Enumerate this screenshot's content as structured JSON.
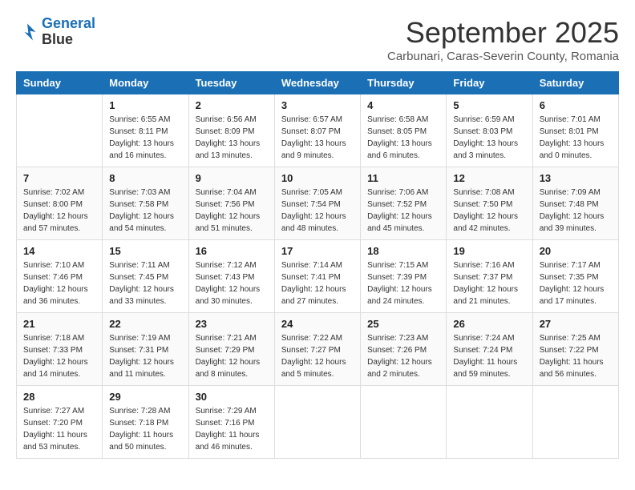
{
  "header": {
    "logo_line1": "General",
    "logo_line2": "Blue",
    "month_title": "September 2025",
    "subtitle": "Carbunari, Caras-Severin County, Romania"
  },
  "weekdays": [
    "Sunday",
    "Monday",
    "Tuesday",
    "Wednesday",
    "Thursday",
    "Friday",
    "Saturday"
  ],
  "weeks": [
    [
      {
        "day": "",
        "sunrise": "",
        "sunset": "",
        "daylight": ""
      },
      {
        "day": "1",
        "sunrise": "Sunrise: 6:55 AM",
        "sunset": "Sunset: 8:11 PM",
        "daylight": "Daylight: 13 hours and 16 minutes."
      },
      {
        "day": "2",
        "sunrise": "Sunrise: 6:56 AM",
        "sunset": "Sunset: 8:09 PM",
        "daylight": "Daylight: 13 hours and 13 minutes."
      },
      {
        "day": "3",
        "sunrise": "Sunrise: 6:57 AM",
        "sunset": "Sunset: 8:07 PM",
        "daylight": "Daylight: 13 hours and 9 minutes."
      },
      {
        "day": "4",
        "sunrise": "Sunrise: 6:58 AM",
        "sunset": "Sunset: 8:05 PM",
        "daylight": "Daylight: 13 hours and 6 minutes."
      },
      {
        "day": "5",
        "sunrise": "Sunrise: 6:59 AM",
        "sunset": "Sunset: 8:03 PM",
        "daylight": "Daylight: 13 hours and 3 minutes."
      },
      {
        "day": "6",
        "sunrise": "Sunrise: 7:01 AM",
        "sunset": "Sunset: 8:01 PM",
        "daylight": "Daylight: 13 hours and 0 minutes."
      }
    ],
    [
      {
        "day": "7",
        "sunrise": "Sunrise: 7:02 AM",
        "sunset": "Sunset: 8:00 PM",
        "daylight": "Daylight: 12 hours and 57 minutes."
      },
      {
        "day": "8",
        "sunrise": "Sunrise: 7:03 AM",
        "sunset": "Sunset: 7:58 PM",
        "daylight": "Daylight: 12 hours and 54 minutes."
      },
      {
        "day": "9",
        "sunrise": "Sunrise: 7:04 AM",
        "sunset": "Sunset: 7:56 PM",
        "daylight": "Daylight: 12 hours and 51 minutes."
      },
      {
        "day": "10",
        "sunrise": "Sunrise: 7:05 AM",
        "sunset": "Sunset: 7:54 PM",
        "daylight": "Daylight: 12 hours and 48 minutes."
      },
      {
        "day": "11",
        "sunrise": "Sunrise: 7:06 AM",
        "sunset": "Sunset: 7:52 PM",
        "daylight": "Daylight: 12 hours and 45 minutes."
      },
      {
        "day": "12",
        "sunrise": "Sunrise: 7:08 AM",
        "sunset": "Sunset: 7:50 PM",
        "daylight": "Daylight: 12 hours and 42 minutes."
      },
      {
        "day": "13",
        "sunrise": "Sunrise: 7:09 AM",
        "sunset": "Sunset: 7:48 PM",
        "daylight": "Daylight: 12 hours and 39 minutes."
      }
    ],
    [
      {
        "day": "14",
        "sunrise": "Sunrise: 7:10 AM",
        "sunset": "Sunset: 7:46 PM",
        "daylight": "Daylight: 12 hours and 36 minutes."
      },
      {
        "day": "15",
        "sunrise": "Sunrise: 7:11 AM",
        "sunset": "Sunset: 7:45 PM",
        "daylight": "Daylight: 12 hours and 33 minutes."
      },
      {
        "day": "16",
        "sunrise": "Sunrise: 7:12 AM",
        "sunset": "Sunset: 7:43 PM",
        "daylight": "Daylight: 12 hours and 30 minutes."
      },
      {
        "day": "17",
        "sunrise": "Sunrise: 7:14 AM",
        "sunset": "Sunset: 7:41 PM",
        "daylight": "Daylight: 12 hours and 27 minutes."
      },
      {
        "day": "18",
        "sunrise": "Sunrise: 7:15 AM",
        "sunset": "Sunset: 7:39 PM",
        "daylight": "Daylight: 12 hours and 24 minutes."
      },
      {
        "day": "19",
        "sunrise": "Sunrise: 7:16 AM",
        "sunset": "Sunset: 7:37 PM",
        "daylight": "Daylight: 12 hours and 21 minutes."
      },
      {
        "day": "20",
        "sunrise": "Sunrise: 7:17 AM",
        "sunset": "Sunset: 7:35 PM",
        "daylight": "Daylight: 12 hours and 17 minutes."
      }
    ],
    [
      {
        "day": "21",
        "sunrise": "Sunrise: 7:18 AM",
        "sunset": "Sunset: 7:33 PM",
        "daylight": "Daylight: 12 hours and 14 minutes."
      },
      {
        "day": "22",
        "sunrise": "Sunrise: 7:19 AM",
        "sunset": "Sunset: 7:31 PM",
        "daylight": "Daylight: 12 hours and 11 minutes."
      },
      {
        "day": "23",
        "sunrise": "Sunrise: 7:21 AM",
        "sunset": "Sunset: 7:29 PM",
        "daylight": "Daylight: 12 hours and 8 minutes."
      },
      {
        "day": "24",
        "sunrise": "Sunrise: 7:22 AM",
        "sunset": "Sunset: 7:27 PM",
        "daylight": "Daylight: 12 hours and 5 minutes."
      },
      {
        "day": "25",
        "sunrise": "Sunrise: 7:23 AM",
        "sunset": "Sunset: 7:26 PM",
        "daylight": "Daylight: 12 hours and 2 minutes."
      },
      {
        "day": "26",
        "sunrise": "Sunrise: 7:24 AM",
        "sunset": "Sunset: 7:24 PM",
        "daylight": "Daylight: 11 hours and 59 minutes."
      },
      {
        "day": "27",
        "sunrise": "Sunrise: 7:25 AM",
        "sunset": "Sunset: 7:22 PM",
        "daylight": "Daylight: 11 hours and 56 minutes."
      }
    ],
    [
      {
        "day": "28",
        "sunrise": "Sunrise: 7:27 AM",
        "sunset": "Sunset: 7:20 PM",
        "daylight": "Daylight: 11 hours and 53 minutes."
      },
      {
        "day": "29",
        "sunrise": "Sunrise: 7:28 AM",
        "sunset": "Sunset: 7:18 PM",
        "daylight": "Daylight: 11 hours and 50 minutes."
      },
      {
        "day": "30",
        "sunrise": "Sunrise: 7:29 AM",
        "sunset": "Sunset: 7:16 PM",
        "daylight": "Daylight: 11 hours and 46 minutes."
      },
      {
        "day": "",
        "sunrise": "",
        "sunset": "",
        "daylight": ""
      },
      {
        "day": "",
        "sunrise": "",
        "sunset": "",
        "daylight": ""
      },
      {
        "day": "",
        "sunrise": "",
        "sunset": "",
        "daylight": ""
      },
      {
        "day": "",
        "sunrise": "",
        "sunset": "",
        "daylight": ""
      }
    ]
  ]
}
